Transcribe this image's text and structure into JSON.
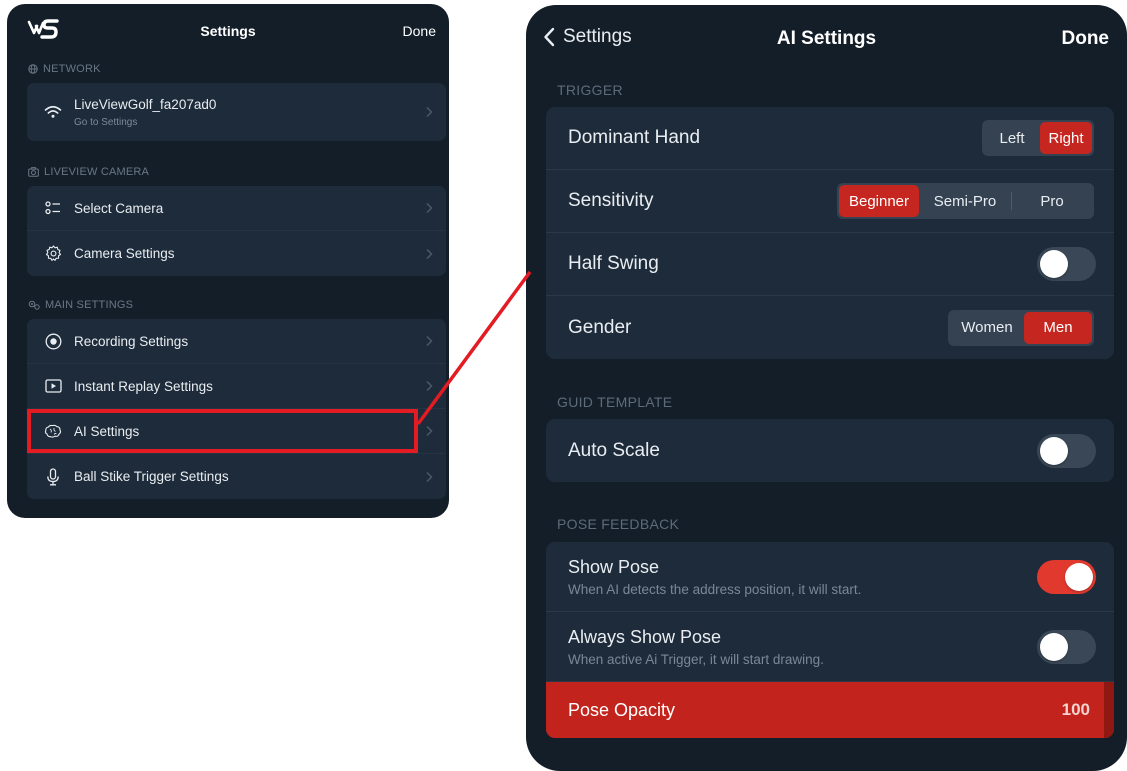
{
  "left": {
    "nav": {
      "logo": "LVS",
      "title": "Settings",
      "done": "Done"
    },
    "network": {
      "header": "NETWORK",
      "wifi": {
        "name": "LiveViewGolf_fa207ad0",
        "sub": "Go to Settings"
      }
    },
    "camera": {
      "header": "LIVEVIEW CAMERA",
      "items": [
        {
          "label": "Select Camera",
          "icon": "list-icon"
        },
        {
          "label": "Camera Settings",
          "icon": "gear-icon"
        }
      ]
    },
    "main": {
      "header": "MAIN SETTINGS",
      "items": [
        {
          "label": "Recording Settings",
          "icon": "record-icon"
        },
        {
          "label": "Instant Replay Settings",
          "icon": "play-icon"
        },
        {
          "label": "AI Settings",
          "icon": "brain-icon"
        },
        {
          "label": "Ball Stike Trigger Settings",
          "icon": "microphone-icon"
        }
      ]
    }
  },
  "right": {
    "nav": {
      "back": "Settings",
      "title": "AI Settings",
      "done": "Done"
    },
    "trigger": {
      "header": "TRIGGER",
      "dominant_hand": {
        "label": "Dominant Hand",
        "options": [
          "Left",
          "Right"
        ],
        "selected": "Right"
      },
      "sensitivity": {
        "label": "Sensitivity",
        "options": [
          "Beginner",
          "Semi-Pro",
          "Pro"
        ],
        "selected": "Beginner"
      },
      "half_swing": {
        "label": "Half Swing",
        "on": false
      },
      "gender": {
        "label": "Gender",
        "options": [
          "Women",
          "Men"
        ],
        "selected": "Men"
      }
    },
    "guide": {
      "header": "GUID TEMPLATE",
      "auto_scale": {
        "label": "Auto Scale",
        "on": false
      }
    },
    "pose": {
      "header": "POSE FEEDBACK",
      "show_pose": {
        "label": "Show Pose",
        "sub": "When AI detects the address position, it will start.",
        "on": true
      },
      "always_show": {
        "label": "Always Show Pose",
        "sub": "When active Ai Trigger, it will start drawing.",
        "on": false
      },
      "opacity": {
        "label": "Pose Opacity",
        "value": "100"
      }
    }
  },
  "colors": {
    "background": "#131e29",
    "card": "#1d2b3a",
    "accent": "#c5261f",
    "highlight": "#e31b23"
  }
}
